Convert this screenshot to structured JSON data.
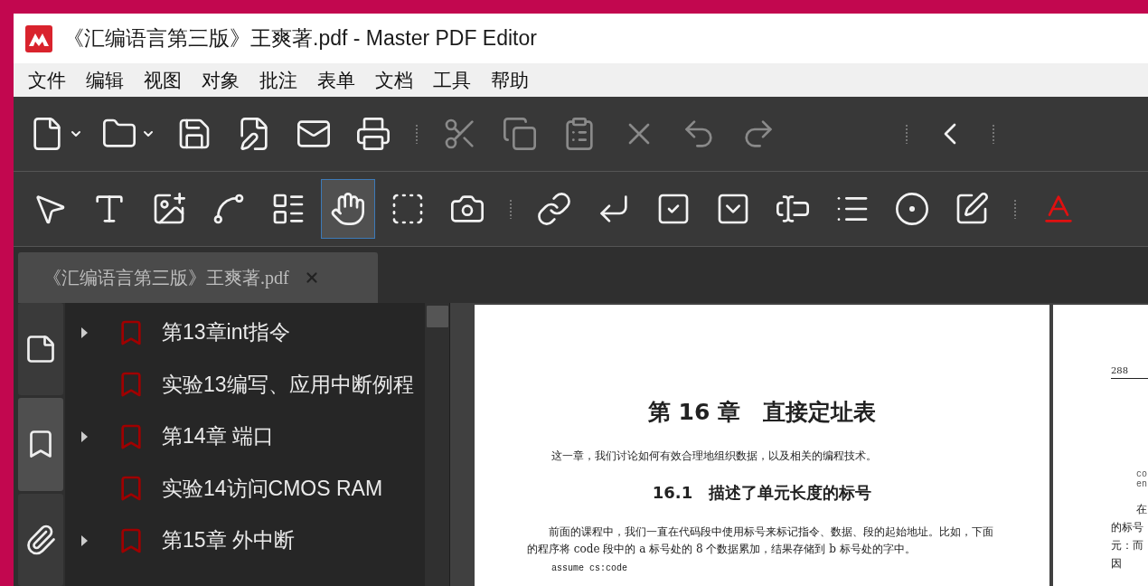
{
  "window": {
    "title": "《汇编语言第三版》王爽著.pdf - Master PDF Editor"
  },
  "menu": [
    "文件",
    "编辑",
    "视图",
    "对象",
    "批注",
    "表单",
    "文档",
    "工具",
    "帮助"
  ],
  "toolbars": [
    {
      "tools": [
        {
          "kind": "split",
          "disabled": false
        },
        {
          "kind": "split",
          "disabled": false
        },
        {
          "kind": "plain",
          "disabled": false
        },
        {
          "kind": "plain",
          "disabled": false
        },
        {
          "kind": "plain",
          "disabled": false
        },
        {
          "kind": "plain",
          "disabled": false
        },
        {
          "kind": "plain",
          "disabled": true
        },
        {
          "kind": "plain",
          "disabled": true
        },
        {
          "kind": "plain",
          "disabled": true
        },
        {
          "kind": "plain",
          "disabled": true
        },
        {
          "kind": "plain",
          "disabled": true
        },
        {
          "kind": "plain",
          "disabled": true
        },
        {
          "kind": "plain",
          "disabled": false
        }
      ]
    },
    {
      "tools": [
        {
          "kind": "plain",
          "selected": false
        },
        {
          "kind": "plain",
          "selected": false
        },
        {
          "kind": "plain",
          "selected": false
        },
        {
          "kind": "plain",
          "selected": false
        },
        {
          "kind": "plain",
          "selected": false
        },
        {
          "kind": "plain",
          "selected": true
        },
        {
          "kind": "plain",
          "selected": false
        },
        {
          "kind": "plain",
          "selected": false
        },
        {
          "kind": "plain",
          "selected": false
        },
        {
          "kind": "plain",
          "selected": false
        },
        {
          "kind": "plain",
          "selected": false
        },
        {
          "kind": "plain",
          "selected": false
        },
        {
          "kind": "plain",
          "selected": false
        },
        {
          "kind": "plain",
          "selected": false
        },
        {
          "kind": "plain",
          "selected": false
        },
        {
          "kind": "plain",
          "selected": false
        },
        {
          "kind": "plain",
          "selected": false
        }
      ]
    }
  ],
  "document_tab": {
    "label": "《汇编语言第三版》王爽著.pdf"
  },
  "side_panel": {
    "tabs": [
      {
        "selected": false
      },
      {
        "selected": true
      },
      {
        "selected": false
      }
    ],
    "bookmarks": [
      {
        "label": "第13章int指令",
        "kind": "group",
        "expanded": false
      },
      {
        "label": "实验13编写、应用中断例程",
        "kind": "leaf"
      },
      {
        "label": "第14章  端口",
        "kind": "group",
        "expanded": false
      },
      {
        "label": "实验14访问CMOS RAM",
        "kind": "leaf"
      },
      {
        "label": "第15章  外中断",
        "kind": "group",
        "expanded": false
      }
    ]
  },
  "pages": [
    {
      "heading": "第 16 章　直接定址表",
      "intro": "这一章，我们讨论如何有效合理地组织数据，以及相关的编程技术。",
      "section": "16.1　描述了单元长度的标号",
      "paragraph": "前面的课程中，我们一直在代码段中使用标号来标记指令、数据、段的起始地址。比如，下面的程序将 code 段中的 a 标号处的 8 个数据累加，结果存储到 b 标号处的字中。",
      "code": "assume cs:code"
    },
    {
      "page_number": "288",
      "code_lines": [
        "co",
        "en"
      ],
      "text_lines": [
        "在",
        "的标号",
        "元：而",
        "因"
      ]
    }
  ]
}
